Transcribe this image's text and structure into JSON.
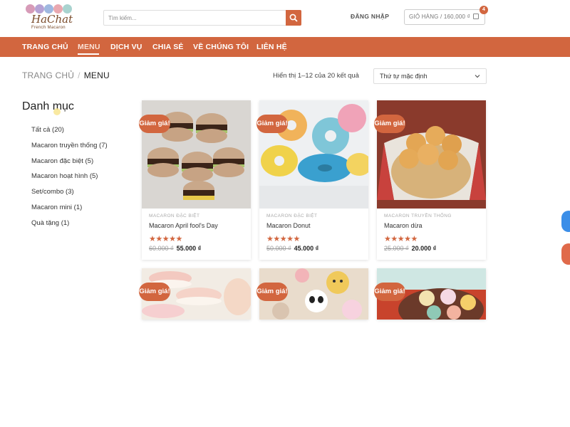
{
  "header": {
    "logo": {
      "brand": "HaChat",
      "tagline": "French Macaron"
    },
    "search_placeholder": "Tìm kiếm...",
    "login_label": "ĐĂNG NHẬP",
    "cart_label": "GIỎ HÀNG / 160,000 ₫",
    "cart_count": "4"
  },
  "nav": {
    "items": [
      {
        "label": "TRANG CHỦ"
      },
      {
        "label": "MENU"
      },
      {
        "label": "DỊCH VỤ"
      },
      {
        "label": "CHIA SẺ"
      },
      {
        "label": "VỀ CHÚNG TÔI"
      },
      {
        "label": "LIÊN HỆ"
      }
    ],
    "active": "MENU"
  },
  "breadcrumb": {
    "home": "TRANG CHỦ",
    "sep": "/",
    "current": "MENU"
  },
  "result_count": "Hiển thị 1–12 của 20 kết quả",
  "sort": {
    "selected": "Thứ tự mặc định"
  },
  "sidebar": {
    "title": "Danh mục",
    "categories": [
      {
        "label": "Tất cả (20)"
      },
      {
        "label": "Macaron truyền thống (7)"
      },
      {
        "label": "Macaron đặc biệt (5)"
      },
      {
        "label": "Macaron hoạt hình (5)"
      },
      {
        "label": "Set/combo (3)"
      },
      {
        "label": "Macaron mini (1)"
      },
      {
        "label": "Quà tặng (1)"
      }
    ]
  },
  "sale_label": "Giảm giá!",
  "products": [
    {
      "category": "MACARON ĐẶC BIỆT",
      "name": "Macaron April fool's Day",
      "stars": "★★★★★",
      "old_price": "60.000 ₫",
      "price": "55.000 ₫"
    },
    {
      "category": "MACARON ĐẶC BIỆT",
      "name": "Macaron Donut",
      "stars": "★★★★★",
      "old_price": "50.000 ₫",
      "price": "45.000 ₫"
    },
    {
      "category": "MACARON TRUYỀN THỐNG",
      "name": "Macaron dừa",
      "stars": "★★★★★",
      "old_price": "25.000 ₫",
      "price": "20.000 ₫"
    }
  ],
  "colors": {
    "accent": "#d2663f",
    "nav_bg": "#d2663f"
  }
}
